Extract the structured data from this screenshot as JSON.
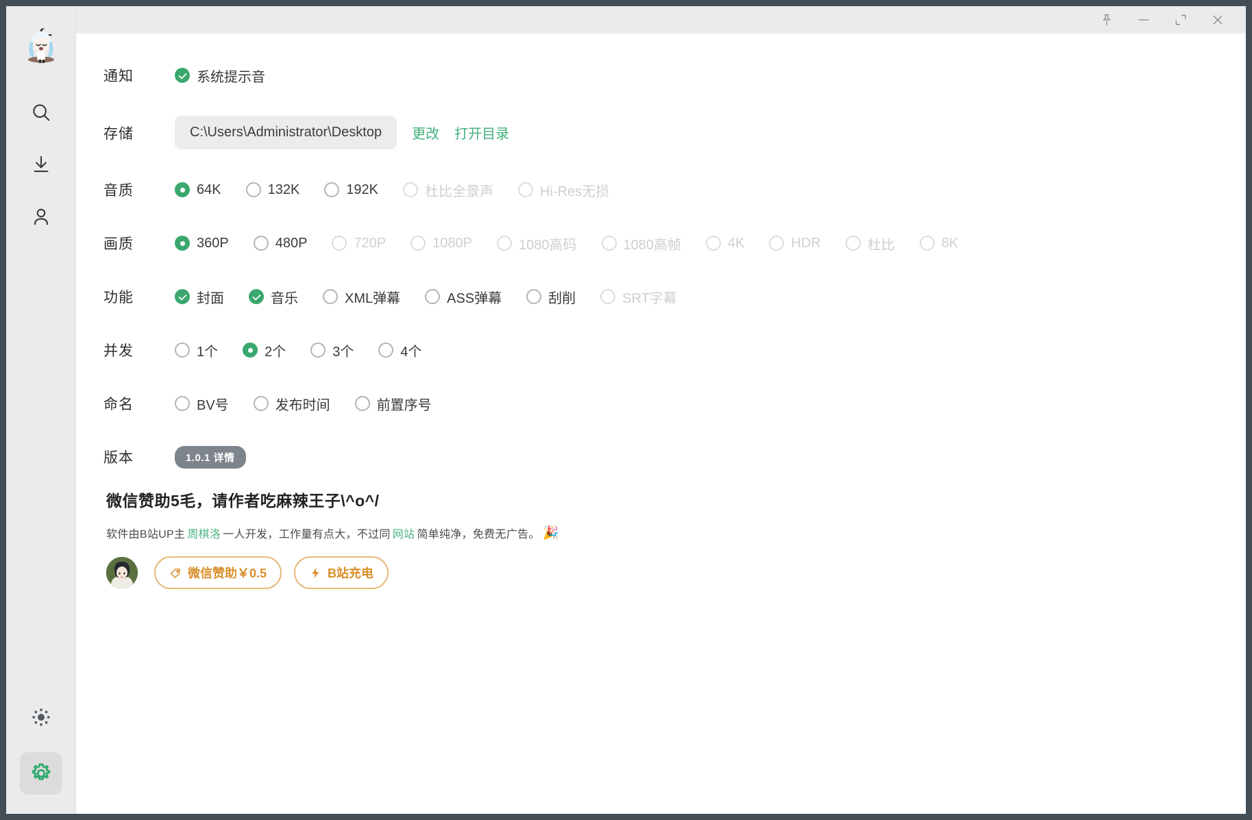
{
  "window": {
    "frame_color": "#434d56",
    "controls": [
      {
        "name": "pin",
        "icon": "pin-icon",
        "label": "置顶"
      },
      {
        "name": "minimize",
        "icon": "minimize-icon",
        "label": "最小化"
      },
      {
        "name": "maximize",
        "icon": "maximize-icon",
        "label": "最大化"
      },
      {
        "name": "close",
        "icon": "close-icon",
        "label": "关闭"
      }
    ]
  },
  "sidebar": {
    "logo": "app-logo",
    "items": [
      {
        "name": "search",
        "icon": "search-icon",
        "active": false
      },
      {
        "name": "download",
        "icon": "download-icon",
        "active": false
      },
      {
        "name": "user",
        "icon": "user-icon",
        "active": false
      }
    ],
    "bottom_items": [
      {
        "name": "theme",
        "icon": "brightness-icon",
        "active": false
      },
      {
        "name": "settings",
        "icon": "gear-icon",
        "active": true
      }
    ],
    "accent": "#2faa6c"
  },
  "settings": {
    "notification": {
      "label": "通知",
      "options": [
        {
          "text": "系统提示音",
          "state": "checked"
        }
      ]
    },
    "storage": {
      "label": "存储",
      "path": "C:\\Users\\Administrator\\Desktop",
      "change_label": "更改",
      "open_label": "打开目录"
    },
    "audio_quality": {
      "label": "音质",
      "options": [
        {
          "text": "64K",
          "state": "selected"
        },
        {
          "text": "132K",
          "state": "normal"
        },
        {
          "text": "192K",
          "state": "normal"
        },
        {
          "text": "杜比全景声",
          "state": "disabled"
        },
        {
          "text": "Hi-Res无损",
          "state": "disabled"
        }
      ]
    },
    "video_quality": {
      "label": "画质",
      "options": [
        {
          "text": "360P",
          "state": "selected"
        },
        {
          "text": "480P",
          "state": "normal"
        },
        {
          "text": "720P",
          "state": "disabled"
        },
        {
          "text": "1080P",
          "state": "disabled"
        },
        {
          "text": "1080高码",
          "state": "disabled"
        },
        {
          "text": "1080高帧",
          "state": "disabled"
        },
        {
          "text": "4K",
          "state": "disabled"
        },
        {
          "text": "HDR",
          "state": "disabled"
        },
        {
          "text": "杜比",
          "state": "disabled"
        },
        {
          "text": "8K",
          "state": "disabled"
        }
      ]
    },
    "features": {
      "label": "功能",
      "options": [
        {
          "text": "封面",
          "state": "checked"
        },
        {
          "text": "音乐",
          "state": "checked"
        },
        {
          "text": "XML弹幕",
          "state": "normal"
        },
        {
          "text": "ASS弹幕",
          "state": "normal"
        },
        {
          "text": "刮削",
          "state": "normal"
        },
        {
          "text": "SRT字幕",
          "state": "disabled"
        }
      ]
    },
    "concurrency": {
      "label": "并发",
      "options": [
        {
          "text": "1个",
          "state": "normal"
        },
        {
          "text": "2个",
          "state": "selected"
        },
        {
          "text": "3个",
          "state": "normal"
        },
        {
          "text": "4个",
          "state": "normal"
        }
      ]
    },
    "naming": {
      "label": "命名",
      "options": [
        {
          "text": "BV号",
          "state": "normal"
        },
        {
          "text": "发布时间",
          "state": "normal"
        },
        {
          "text": "前置序号",
          "state": "normal"
        }
      ]
    },
    "version": {
      "label": "版本",
      "badge": "1.0.1 详情"
    }
  },
  "sponsor": {
    "title": "微信赞助5毛，请作者吃麻辣王子\\^o^/",
    "desc_1": "软件由B站UP主",
    "desc_link_1": "周棋洛",
    "desc_2": "一人开发，工作量有点大，不过同",
    "desc_link_2": "网站",
    "desc_3": "简单纯净，免费无广告。",
    "emoji": "🎉",
    "avatar": "author-avatar",
    "buttons": [
      {
        "icon": "tag-icon",
        "label": "微信赞助￥0.5"
      },
      {
        "icon": "lightning-icon",
        "label": "B站充电"
      }
    ],
    "accent": "#d98f2b"
  }
}
